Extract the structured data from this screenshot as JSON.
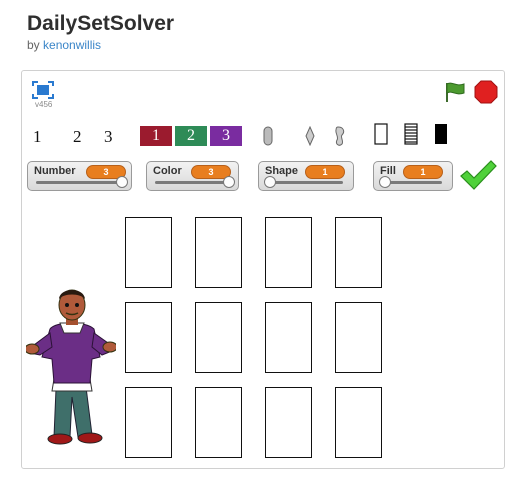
{
  "project": {
    "title": "DailySetSolver",
    "by_label": "by",
    "author": "kenonwillis"
  },
  "stage": {
    "version": "v456"
  },
  "numbers": [
    "1",
    "2",
    "3"
  ],
  "color_swatches": [
    {
      "label": "1",
      "color": "#9b1b2e"
    },
    {
      "label": "2",
      "color": "#2e8b57"
    },
    {
      "label": "3",
      "color": "#7a2ca0"
    }
  ],
  "sliders": [
    {
      "label": "Number",
      "value": "3",
      "level": 1.0
    },
    {
      "label": "Color",
      "value": "3",
      "level": 1.0
    },
    {
      "label": "Shape",
      "value": "1",
      "level": 0.0
    },
    {
      "label": "Fill",
      "value": "1",
      "level": 0.0
    }
  ],
  "icons": {
    "fullscreen": "fullscreen-icon",
    "flag": "green-flag-icon",
    "stop": "stop-icon",
    "check": "checkmark-icon",
    "shapes": [
      "oval-shape-icon",
      "diamond-shape-icon",
      "squiggle-shape-icon"
    ],
    "fills": [
      "empty-fill-icon",
      "striped-fill-icon",
      "solid-fill-icon"
    ]
  },
  "card_grid": {
    "rows": 3,
    "cols": 4
  }
}
